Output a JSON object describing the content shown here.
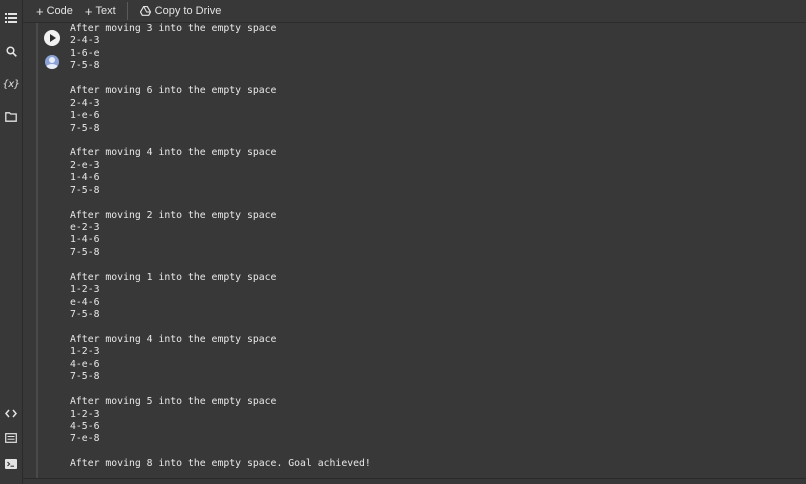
{
  "toolbar": {
    "code_label": "Code",
    "text_label": "Text",
    "drive_label": "Copy to Drive"
  },
  "rail": {
    "icons": [
      "table-of-contents-icon",
      "search-icon",
      "variables-icon",
      "files-icon",
      "code-snippets-icon",
      "command-palette-icon",
      "terminal-icon"
    ],
    "variables_glyph": "{x}"
  },
  "output": {
    "blocks": [
      {
        "heading": "After moving 3 into the empty space",
        "rows": [
          "2-4-3",
          "1-6-e",
          "7-5-8"
        ]
      },
      {
        "heading": "After moving 6 into the empty space",
        "rows": [
          "2-4-3",
          "1-e-6",
          "7-5-8"
        ]
      },
      {
        "heading": "After moving 4 into the empty space",
        "rows": [
          "2-e-3",
          "1-4-6",
          "7-5-8"
        ]
      },
      {
        "heading": "After moving 2 into the empty space",
        "rows": [
          "e-2-3",
          "1-4-6",
          "7-5-8"
        ]
      },
      {
        "heading": "After moving 1 into the empty space",
        "rows": [
          "1-2-3",
          "e-4-6",
          "7-5-8"
        ]
      },
      {
        "heading": "After moving 4 into the empty space",
        "rows": [
          "1-2-3",
          "4-e-6",
          "7-5-8"
        ]
      },
      {
        "heading": "After moving 5 into the empty space",
        "rows": [
          "1-2-3",
          "4-5-6",
          "7-e-8"
        ]
      },
      {
        "heading": "After moving 8 into the empty space. Goal achieved!",
        "rows": []
      }
    ]
  }
}
